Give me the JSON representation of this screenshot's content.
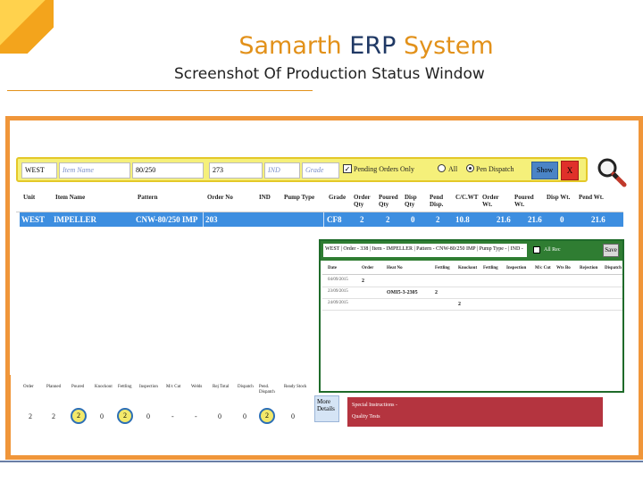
{
  "slide": {
    "title_part1": "Samarth",
    "title_part2": "ERP",
    "title_part3": "System",
    "subtitle": "Screenshot Of Production Status Window"
  },
  "filter_bar": {
    "unit_value": "WEST",
    "item_name_placeholder": "Item Name",
    "pattern_value": "80/250",
    "order_no_value": "273",
    "ind_placeholder": "IND",
    "grade_placeholder": "Grade",
    "pending_orders_label": "Pending Orders Only",
    "pending_orders_checked": true,
    "radio_all_label": "All",
    "radio_pen_dispatch_label": "Pen Dispatch",
    "selected_radio": "Pen Dispatch",
    "show_button": "Show",
    "close_button": "X"
  },
  "grid": {
    "headers": [
      "Unit",
      "Item Name",
      "Pattern",
      "Order No",
      "IND",
      "Pump Type",
      "Grade",
      "Order Qty",
      "Poured Qty",
      "Disp Qty",
      "Pend Disp.",
      "C/C.WT",
      "Order Wt.",
      "Poured Wt.",
      "Disp Wt.",
      "Pend Wt."
    ],
    "row": {
      "unit": "WEST",
      "item_name": "IMPELLER",
      "pattern": "CNW-80/250 IMP",
      "order_no": "203",
      "ind": "",
      "pump_type": "",
      "grade": "CF8",
      "order_qty": "2",
      "poured_qty": "2",
      "disp_qty": "0",
      "pend_disp": "2",
      "cc_wt": "10.8",
      "order_wt": "21.6",
      "poured_wt": "21.6",
      "disp_wt": "0",
      "pend_wt": "21.6"
    }
  },
  "popup": {
    "title": "WEST | Order - 338 | Item - IMPELLER | Pattern - CNW-80/250 IMP | Pump Type - | IND -",
    "all_rec_label": "All Rec",
    "save_button": "Save",
    "close_button": "...",
    "headers": [
      "Date",
      "Order",
      "Heat No",
      "Fettling",
      "Knockout",
      "Fettling",
      "Inspection",
      "M/c Cut",
      "Wts Bo",
      "Rejection",
      "Dispatch"
    ],
    "rows": [
      {
        "date": "04/09/2015",
        "order": "2",
        "heat_no": "",
        "qty": ""
      },
      {
        "date": "23/09/2015",
        "order": "",
        "heat_no": "OMI5-3-2305",
        "qty": "2"
      },
      {
        "date": "24/09/2015",
        "order": "",
        "heat_no": "",
        "qty": "2"
      }
    ]
  },
  "stats": {
    "headers": [
      "Order",
      "Planned",
      "Poured",
      "Knockout",
      "Fettling",
      "Inspection",
      "M/c Cut",
      "Welds",
      "Rej Total",
      "Dispatch",
      "Pend. Dispatch",
      "Ready Stock"
    ],
    "values": [
      "2",
      "2",
      "2",
      "0",
      "2",
      "0",
      "-",
      "-",
      "0",
      "0",
      "2",
      "0"
    ],
    "highlighted": [
      2,
      4,
      10
    ]
  },
  "more_details": "More Details",
  "special_panel": {
    "line1": "Special Instructions -",
    "line2": "Quality Tests"
  }
}
